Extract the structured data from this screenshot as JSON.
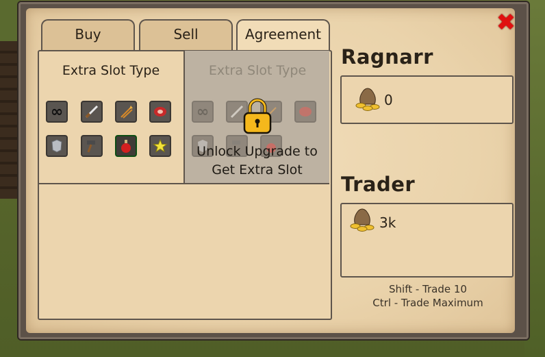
{
  "tabs": [
    {
      "label": "Buy"
    },
    {
      "label": "Sell"
    },
    {
      "label": "Agreement"
    }
  ],
  "agreement": {
    "slot_title_left": "Extra Slot Type",
    "slot_title_right": "Extra Slot Type",
    "slot_icons": [
      "infinity-icon",
      "sword-icon",
      "arrows-icon",
      "meat-icon",
      "armor-icon",
      "hammer-icon",
      "potion-icon",
      "star-icon"
    ],
    "selected_slot": "potion-icon",
    "unlock_line1": "Unlock Upgrade to",
    "unlock_line2": "Get Extra Slot"
  },
  "player": {
    "name": "Ragnarr",
    "gold": "0"
  },
  "trader": {
    "name": "Trader",
    "gold": "3k"
  },
  "hints": {
    "line1": "Shift - Trade 10",
    "line2": "Ctrl - Trade Maximum"
  },
  "colors": {
    "close": "#e01010",
    "parchment": "#ead3ab",
    "border": "#5e554c"
  }
}
